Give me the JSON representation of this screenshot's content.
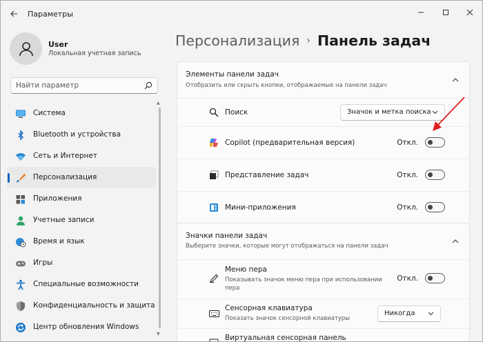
{
  "window": {
    "title": "Параметры"
  },
  "profile": {
    "name": "User",
    "account_type": "Локальная учетная запись"
  },
  "search": {
    "placeholder": "Найти параметр"
  },
  "sidebar": {
    "items": [
      {
        "label": "Система",
        "icon": "monitor-icon"
      },
      {
        "label": "Bluetooth и устройства",
        "icon": "bluetooth-icon"
      },
      {
        "label": "Сеть и Интернет",
        "icon": "wifi-icon"
      },
      {
        "label": "Персонализация",
        "icon": "brush-icon",
        "active": true
      },
      {
        "label": "Приложения",
        "icon": "apps-icon"
      },
      {
        "label": "Учетные записи",
        "icon": "person-icon"
      },
      {
        "label": "Время и язык",
        "icon": "globe-clock-icon"
      },
      {
        "label": "Игры",
        "icon": "gamepad-icon"
      },
      {
        "label": "Специальные возможности",
        "icon": "accessibility-icon"
      },
      {
        "label": "Конфиденциальность и защита",
        "icon": "shield-icon"
      },
      {
        "label": "Центр обновления Windows",
        "icon": "update-icon"
      }
    ]
  },
  "breadcrumb": {
    "parent": "Персонализация",
    "separator": "›",
    "current": "Панель задач"
  },
  "taskbar_items": {
    "title": "Элементы панели задач",
    "subtitle": "Отобразить или скрыть кнопки, отображаемые на панели задач",
    "rows": [
      {
        "label": "Поиск",
        "icon": "search-icon",
        "dropdown_value": "Значок и метка поиска"
      },
      {
        "label": "Copilot (предварительная версия)",
        "icon": "copilot-icon",
        "state": "Откл."
      },
      {
        "label": "Представление задач",
        "icon": "task-view-icon",
        "state": "Откл."
      },
      {
        "label": "Мини-приложения",
        "icon": "widgets-icon",
        "state": "Откл."
      }
    ]
  },
  "taskbar_icons": {
    "title": "Значки панели задач",
    "subtitle": "Выберите значки, которые могут отображаться на панели задач",
    "rows": [
      {
        "label": "Меню пера",
        "sub": "Показывать значок меню пера при использовании пера",
        "icon": "pen-icon",
        "state": "Откл."
      },
      {
        "label": "Сенсорная клавиатура",
        "sub": "Показать значок сенсорной клавиатуры",
        "icon": "keyboard-icon",
        "dropdown_value": "Никогда"
      },
      {
        "label": "Виртуальная сенсорная панель",
        "icon": "touchpad-icon"
      }
    ]
  },
  "colors": {
    "accent": "#0067c0",
    "annotation_arrow": "#e02020"
  }
}
